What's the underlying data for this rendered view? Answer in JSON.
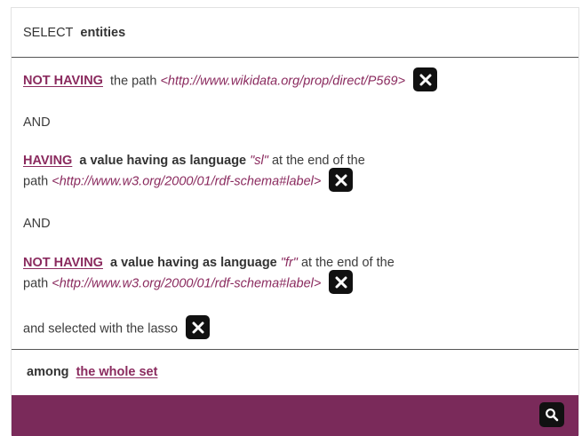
{
  "header": {
    "keyword": "SELECT",
    "entities": "entities"
  },
  "clauses": [
    {
      "operator": "NOT HAVING",
      "text": "the path",
      "path": "<http://www.wikidata.org/prop/direct/P569>"
    },
    {
      "operator": "HAVING",
      "bold": "a value having as language",
      "lang": "\"sl\"",
      "text_after": "at the end of the",
      "text2": "path",
      "path": "<http://www.w3.org/2000/01/rdf-schema#label>"
    },
    {
      "operator": "NOT HAVING",
      "bold": "a value having as language",
      "lang": "\"fr\"",
      "text_after": "at the end of the",
      "text2": "path",
      "path": "<http://www.w3.org/2000/01/rdf-schema#label>"
    }
  ],
  "and_label": "AND",
  "lasso": "and selected with the lasso",
  "among": {
    "label": "among",
    "set": "the whole set"
  },
  "icons": {
    "remove": "close-icon",
    "search": "search-icon"
  },
  "colors": {
    "accent": "#8a2a5e",
    "footer": "#7a2a5a",
    "button": "#111111"
  }
}
